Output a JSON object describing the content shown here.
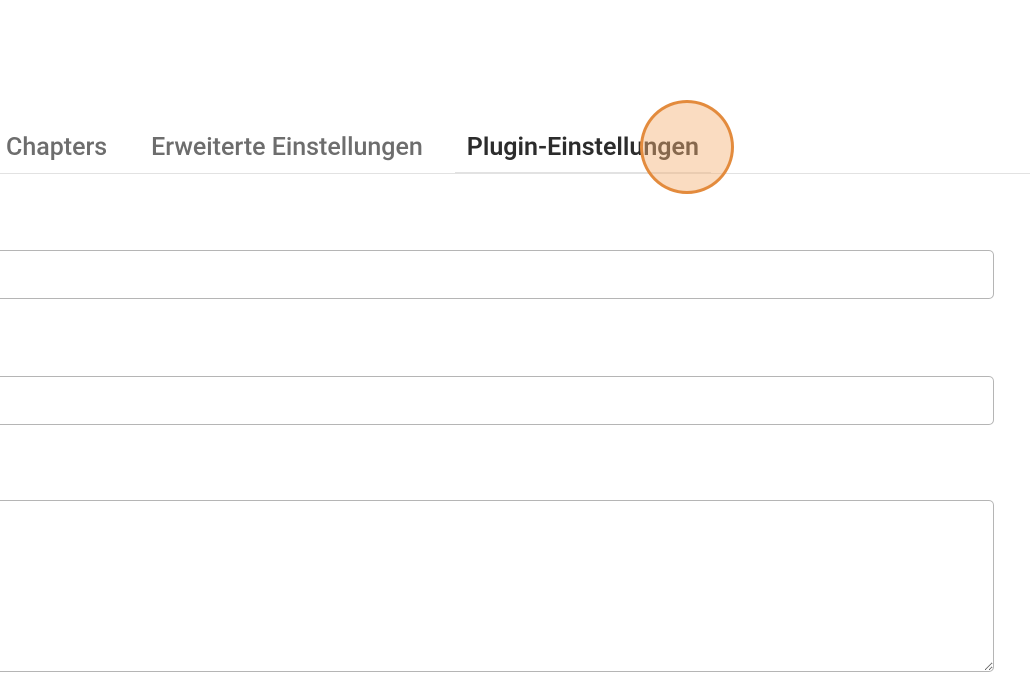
{
  "tabs": {
    "items": [
      {
        "label": "Chapters",
        "active": false
      },
      {
        "label": "Erweiterte Einstellungen",
        "active": false
      },
      {
        "label": "Plugin-Einstellungen",
        "active": true
      }
    ]
  },
  "form": {
    "field1_value": "",
    "field2_value": "",
    "textarea_value": ""
  }
}
